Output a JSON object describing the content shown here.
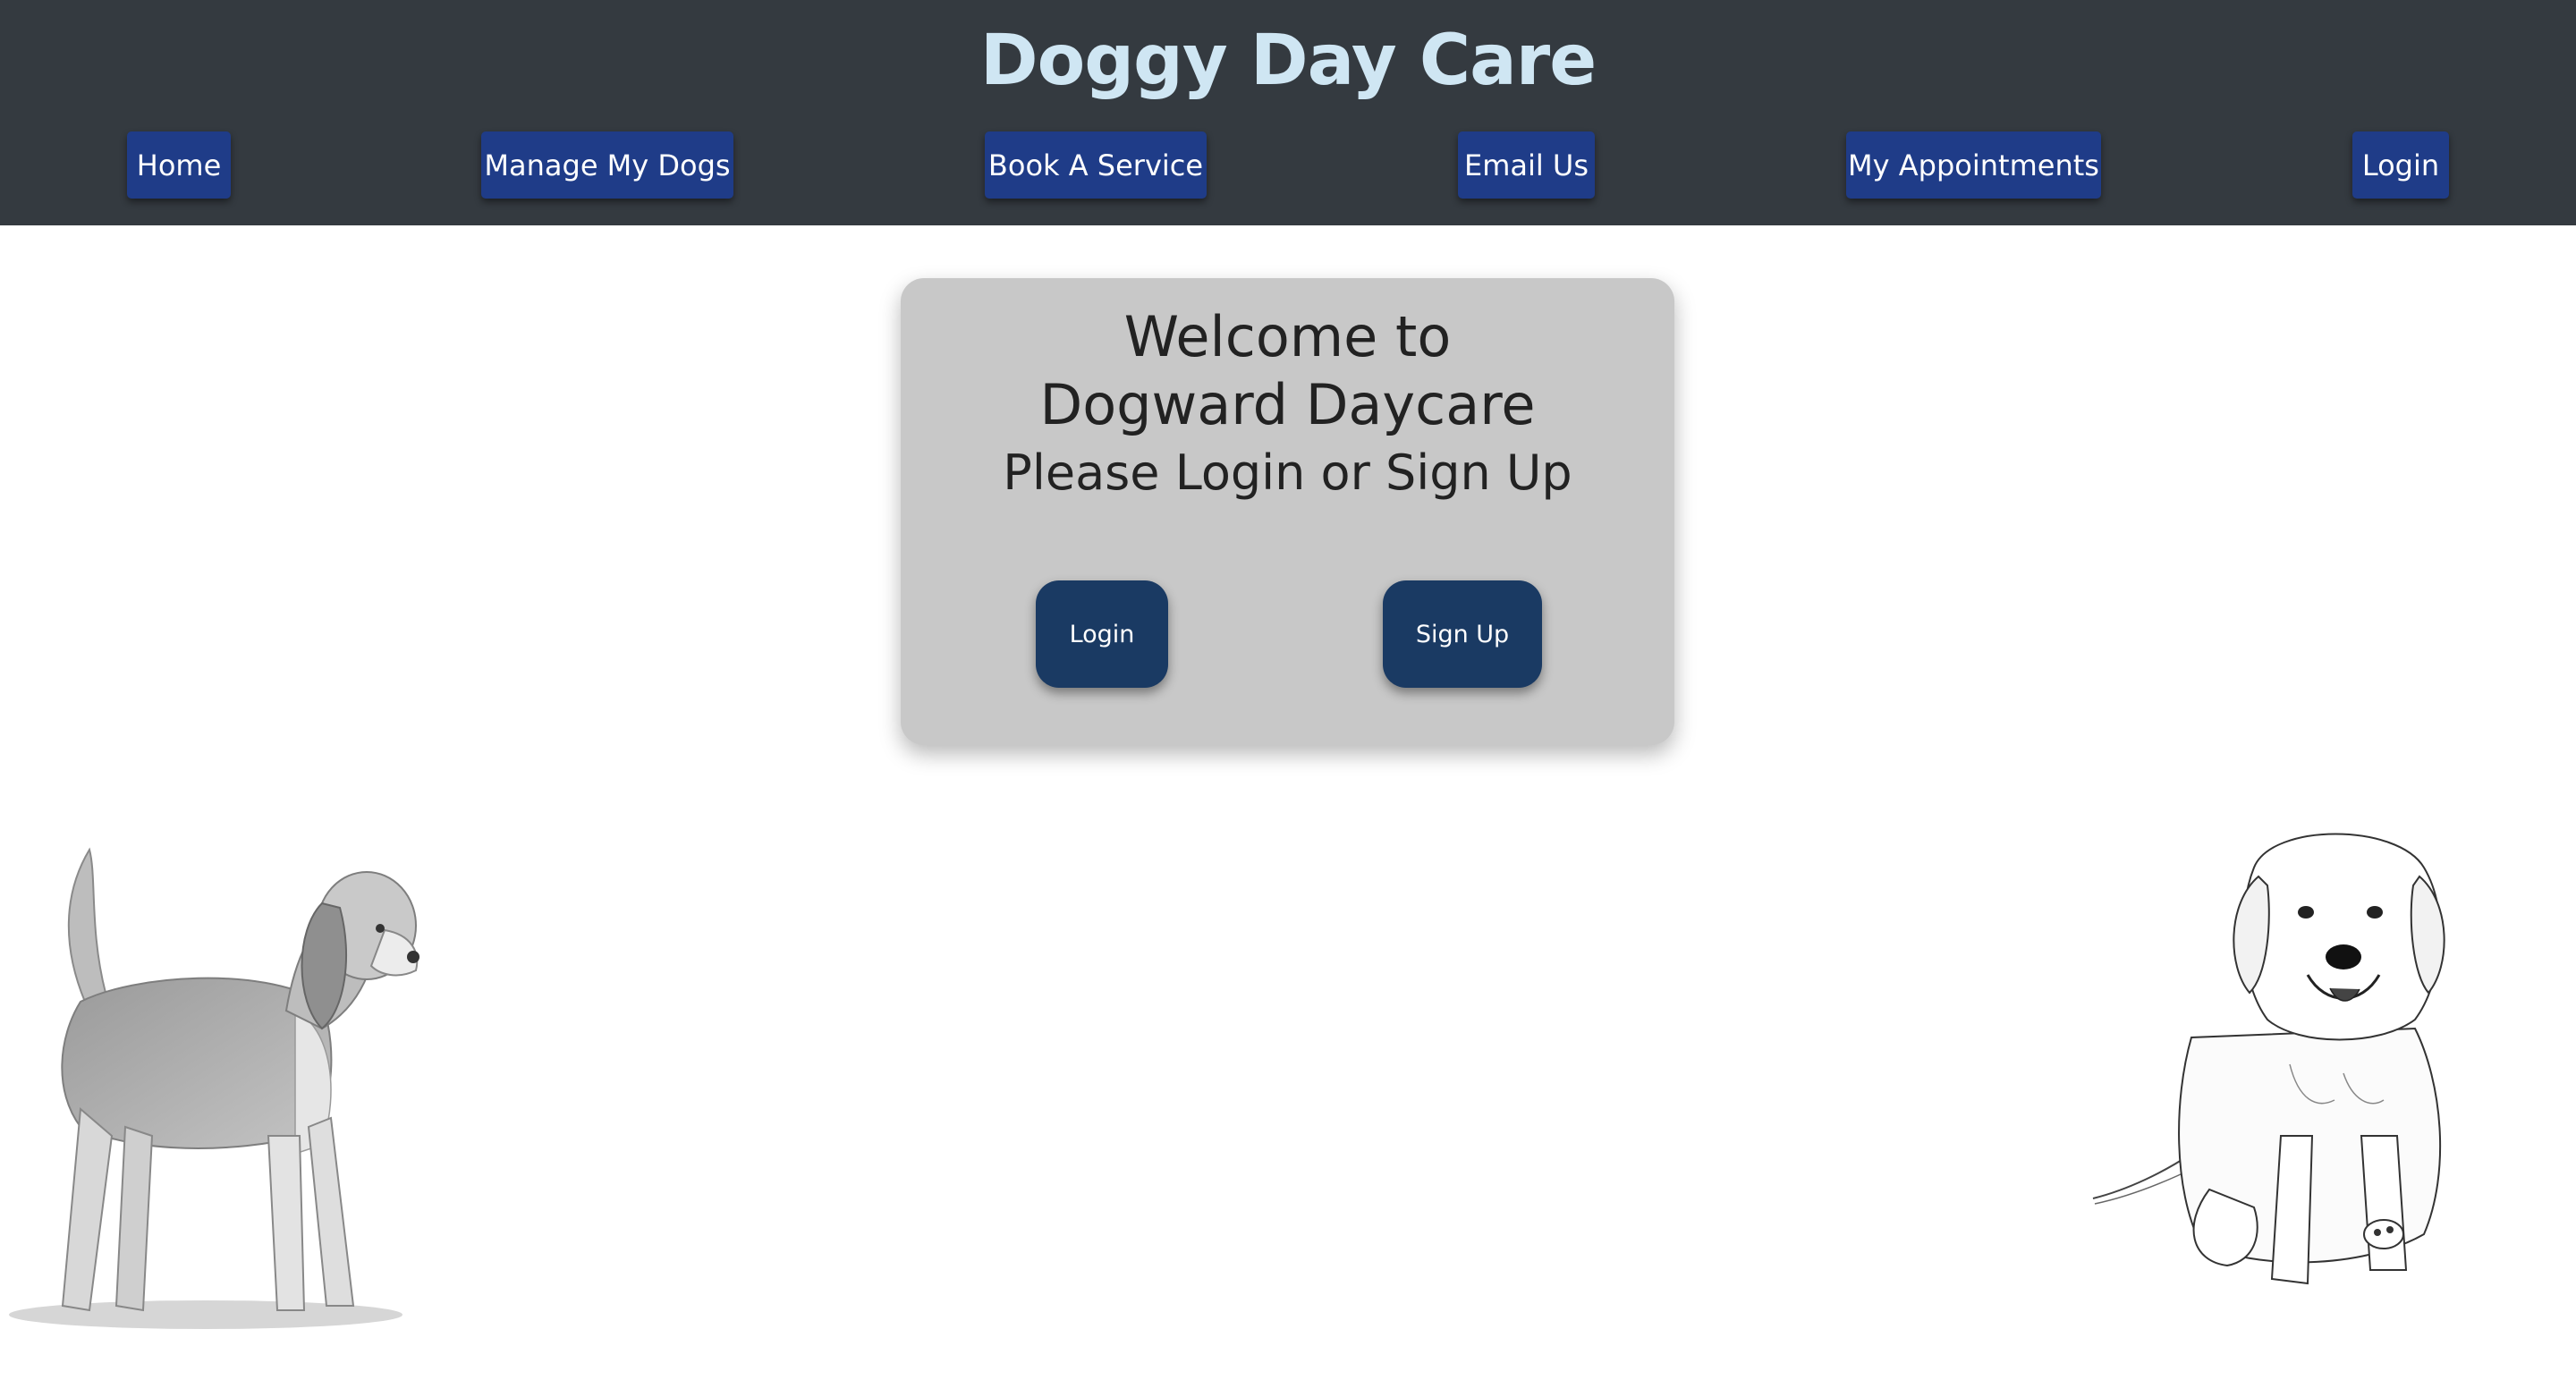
{
  "header": {
    "brand": "Doggy Day Care",
    "nav": {
      "home": "Home",
      "manage_dogs": "Manage My Dogs",
      "book_service": "Book A Service",
      "email_us": "Email Us",
      "my_appointments": "My Appointments",
      "login": "Login"
    }
  },
  "card": {
    "title": "Welcome to Dogward Daycare",
    "subtitle": "Please Login or Sign Up",
    "login_label": "Login",
    "signup_label": "Sign Up"
  },
  "illustrations": {
    "left": "beagle-sketch",
    "right": "golden-retriever-puppy-sketch"
  },
  "colors": {
    "header_bg": "#343a40",
    "brand_text": "#cfe6f3",
    "nav_button": "#1f3c88",
    "card_bg": "#c8c8c8",
    "card_button": "#1a3a63"
  }
}
